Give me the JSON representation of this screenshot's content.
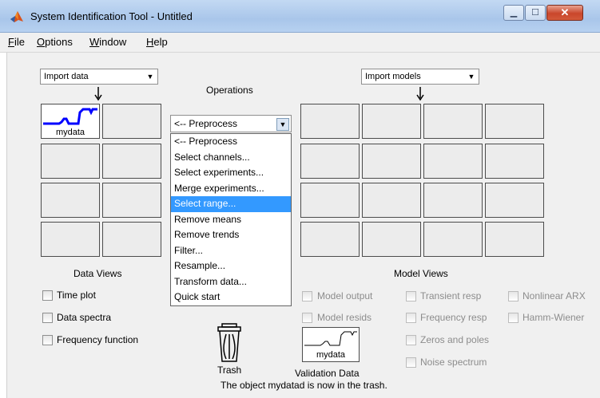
{
  "window": {
    "title": "System Identification Tool - Untitled"
  },
  "menu": [
    {
      "label": "File",
      "key": "F",
      "rest": "ile"
    },
    {
      "label": "Options",
      "key": "O",
      "rest": "ptions"
    },
    {
      "label": "Window",
      "key": "W",
      "rest": "indow"
    },
    {
      "label": "Help",
      "key": "H",
      "rest": "elp"
    }
  ],
  "import_data": {
    "value": "Import data"
  },
  "import_models": {
    "value": "Import models"
  },
  "operations": {
    "label": "Operations",
    "selected": "<-- Preprocess",
    "options": [
      "<-- Preprocess",
      "Select channels...",
      "Select experiments...",
      "Merge experiments...",
      "Select range...",
      "Remove means",
      "Remove trends",
      "Filter...",
      "Resample...",
      "Transform data...",
      "Quick start"
    ],
    "highlighted_index": 4
  },
  "data_board": {
    "item_label": "mydata",
    "color": "#0000ff"
  },
  "data_views": {
    "label": "Data Views",
    "checks": [
      "Time plot",
      "Data spectra",
      "Frequency function"
    ]
  },
  "model_views": {
    "label": "Model Views",
    "col1": [
      "Model output",
      "Model resids"
    ],
    "col2": [
      "Transient resp",
      "Frequency resp",
      "Zeros and poles",
      "Noise spectrum"
    ],
    "col3": [
      "Nonlinear ARX",
      "Hamm-Wiener"
    ]
  },
  "trash": {
    "label": "Trash"
  },
  "validation": {
    "item_label": "mydata",
    "label": "Validation Data"
  },
  "status": {
    "text": "The object mydatad is now in the trash."
  }
}
